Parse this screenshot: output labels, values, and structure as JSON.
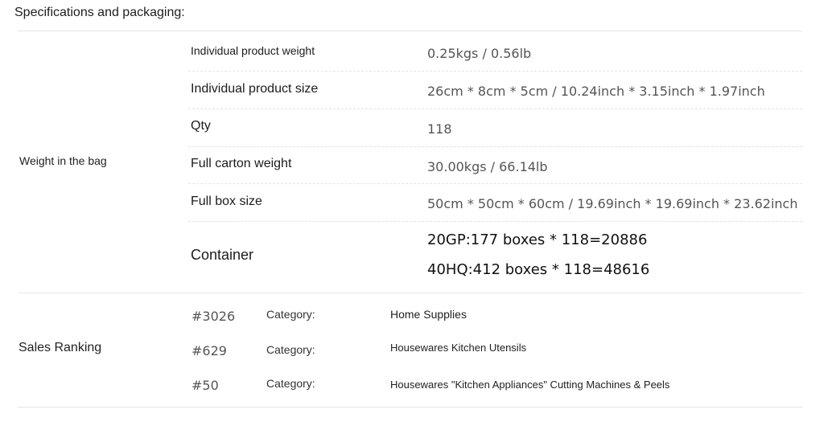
{
  "page": {
    "title": "Specifications and packaging:"
  },
  "weight_group": {
    "label": "Weight in the bag",
    "rows": [
      {
        "label": "Individual product weight",
        "value": "0.25kgs / 0.56lb"
      },
      {
        "label": "Individual product size",
        "value": "26cm * 8cm * 5cm / 10.24inch * 3.15inch * 1.97inch"
      },
      {
        "label": "Qty",
        "value": "118"
      },
      {
        "label": "Full carton weight",
        "value": "30.00kgs / 66.14lb"
      },
      {
        "label": "Full box size",
        "value": "50cm * 50cm * 60cm / 19.69inch * 19.69inch * 23.62inch"
      }
    ],
    "container": {
      "label": "Container",
      "lines": [
        "20GP:177 boxes * 118=20886",
        "40HQ:412 boxes * 118=48616"
      ]
    }
  },
  "sales_ranking": {
    "label": "Sales Ranking",
    "rows": [
      {
        "rank": "#3026",
        "category_label": "Category:",
        "category": "Home Supplies"
      },
      {
        "rank": "#629",
        "category_label": "Category:",
        "category": "Housewares Kitchen Utensils"
      },
      {
        "rank": "#50",
        "category_label": "Category:",
        "category": "Housewares \"Kitchen Appliances\" Cutting Machines & Peels"
      }
    ]
  }
}
